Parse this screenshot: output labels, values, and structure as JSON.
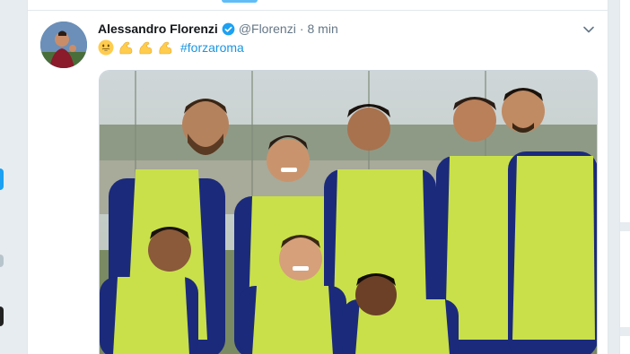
{
  "tweet": {
    "display_name": "Alessandro Florenzi",
    "handle": "@Florenzi",
    "separator": "·",
    "time": "8 min",
    "emojis": [
      "grinning-face",
      "flexed-biceps",
      "flexed-biceps",
      "flexed-biceps"
    ],
    "hashtag": "#forzaroma"
  },
  "colors": {
    "accent": "#1da1f2",
    "hashtag": "#1b95e0",
    "text_primary": "#14171a",
    "text_secondary": "#657786",
    "page_background": "#e6ecf0",
    "training_bib": "#c9e04a",
    "jersey_navy": "#1b2a7a"
  },
  "icons": {
    "verified": "verified-badge-icon",
    "caret": "chevron-down-icon"
  }
}
